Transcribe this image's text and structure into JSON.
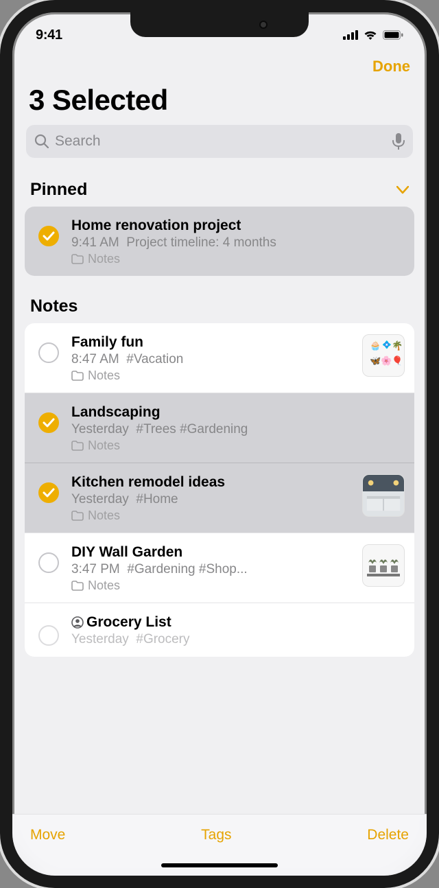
{
  "status": {
    "time": "9:41"
  },
  "nav": {
    "done": "Done"
  },
  "title": "3 Selected",
  "search": {
    "placeholder": "Search"
  },
  "sections": {
    "pinned": {
      "header": "Pinned"
    },
    "notes": {
      "header": "Notes"
    }
  },
  "pinned": [
    {
      "title": "Home renovation project",
      "time": "9:41 AM",
      "preview": "Project timeline: 4 months",
      "folder": "Notes",
      "selected": true
    }
  ],
  "notes": [
    {
      "title": "Family fun",
      "time": "8:47 AM",
      "preview": "#Vacation",
      "folder": "Notes",
      "selected": false,
      "thumb": "stickers"
    },
    {
      "title": "Landscaping",
      "time": "Yesterday",
      "preview": "#Trees #Gardening",
      "folder": "Notes",
      "selected": true
    },
    {
      "title": "Kitchen remodel ideas",
      "time": "Yesterday",
      "preview": "#Home",
      "folder": "Notes",
      "selected": true,
      "thumb": "kitchen"
    },
    {
      "title": "DIY Wall Garden",
      "time": "3:47 PM",
      "preview": "#Gardening #Shop...",
      "folder": "Notes",
      "selected": false,
      "thumb": "plants"
    },
    {
      "title": "Grocery List",
      "time": "Yesterday",
      "preview": "#Grocery",
      "folder": "Notes",
      "selected": false,
      "shared": true
    }
  ],
  "toolbar": {
    "move": "Move",
    "tags": "Tags",
    "delete": "Delete"
  }
}
